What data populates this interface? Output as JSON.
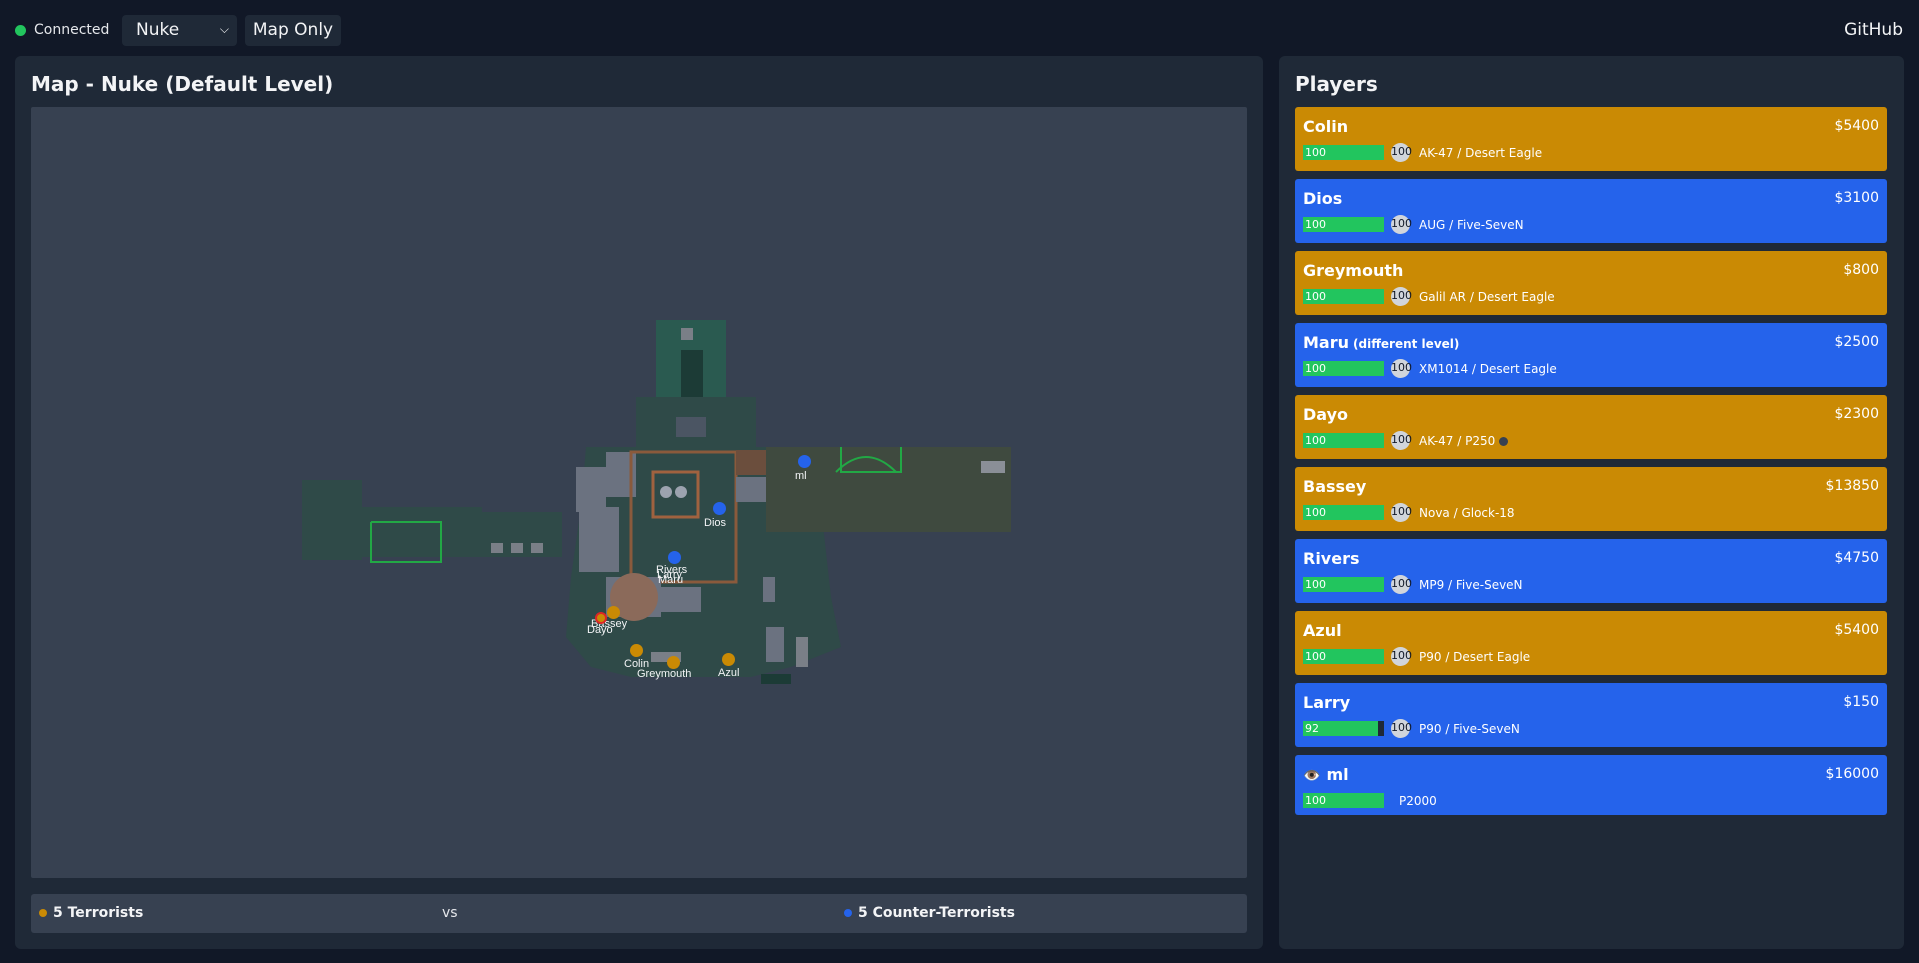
{
  "header": {
    "status_label": "Connected",
    "status_color": "#22c55e",
    "map_select_value": "Nuke",
    "map_only_label": "Map Only",
    "github_label": "GitHub"
  },
  "map_panel": {
    "title": "Map - Nuke (Default Level)",
    "markers": [
      {
        "name": "ml",
        "team": "ct"
      },
      {
        "name": "Dios",
        "team": "ct"
      },
      {
        "name": "Rivers",
        "team": "ct"
      },
      {
        "name": "Larry",
        "team": "ct"
      },
      {
        "name": "Maru",
        "team": "ct"
      },
      {
        "name": "Bassey",
        "team": "t"
      },
      {
        "name": "Dayo",
        "team": "t"
      },
      {
        "name": "Colin",
        "team": "t"
      },
      {
        "name": "Greymouth",
        "team": "t"
      },
      {
        "name": "Azul",
        "team": "t"
      }
    ]
  },
  "team_bar": {
    "terrorists_label": "5 Terrorists",
    "vs_label": "vs",
    "ct_label": "5 Counter-Terrorists",
    "t_color": "#ca8a04",
    "ct_color": "#2563eb"
  },
  "players_panel": {
    "title": "Players",
    "players": [
      {
        "name": "Colin",
        "team": "t",
        "money": "$5400",
        "health": 100,
        "armor": "100",
        "weapons": "AK-47 / Desert Eagle"
      },
      {
        "name": "Dios",
        "team": "ct",
        "money": "$3100",
        "health": 100,
        "armor": "100",
        "weapons": "AUG / Five-SeveN"
      },
      {
        "name": "Greymouth",
        "team": "t",
        "money": "$800",
        "health": 100,
        "armor": "100",
        "weapons": "Galil AR / Desert Eagle"
      },
      {
        "name": "Maru",
        "note": "(different level)",
        "team": "ct",
        "money": "$2500",
        "health": 100,
        "armor": "100",
        "weapons": "XM1014 / Desert Eagle"
      },
      {
        "name": "Dayo",
        "team": "t",
        "money": "$2300",
        "health": 100,
        "armor": "100",
        "weapons": "AK-47 / P250",
        "has_bomb": true
      },
      {
        "name": "Bassey",
        "team": "t",
        "money": "$13850",
        "health": 100,
        "armor": "100",
        "weapons": "Nova / Glock-18"
      },
      {
        "name": "Rivers",
        "team": "ct",
        "money": "$4750",
        "health": 100,
        "armor": "100",
        "weapons": "MP9 / Five-SeveN"
      },
      {
        "name": "Azul",
        "team": "t",
        "money": "$5400",
        "health": 100,
        "armor": "100",
        "weapons": "P90 / Desert Eagle"
      },
      {
        "name": "Larry",
        "team": "ct",
        "money": "$150",
        "health": 92,
        "armor": "100",
        "weapons": "P90 / Five-SeveN"
      },
      {
        "name": "ml",
        "team": "ct",
        "money": "$16000",
        "health": 100,
        "armor": null,
        "weapons": "P2000",
        "spectated": true,
        "spectate_icon": "👁️"
      }
    ]
  }
}
